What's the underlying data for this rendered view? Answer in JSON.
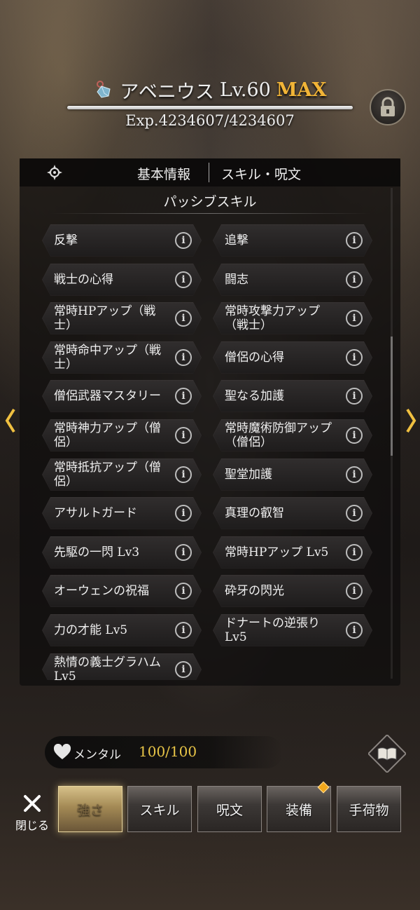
{
  "header": {
    "name": "アベニウス",
    "level": "Lv.60",
    "max_label": "MAX",
    "exp": "Exp.4234607/4234607"
  },
  "tabs": {
    "basic": "基本情報",
    "skill": "スキル・呪文"
  },
  "section_title": "パッシブスキル",
  "skills": [
    "反撃",
    "追撃",
    "戦士の心得",
    "闘志",
    "常時HPアップ（戦士）",
    "常時攻撃力アップ（戦士）",
    "常時命中アップ（戦士）",
    "僧侶の心得",
    "僧侶武器マスタリー",
    "聖なる加護",
    "常時神力アップ（僧侶）",
    "常時魔術防御アップ（僧侶）",
    "常時抵抗アップ（僧侶）",
    "聖堂加護",
    "アサルトガード",
    "真理の叡智",
    "先駆の一閃 Lv3",
    "常時HPアップ Lv5",
    "オーウェンの祝福",
    "砕牙の閃光",
    "力の才能 Lv5",
    "ドナートの逆張り Lv5",
    "熱情の義士グラハム Lv5"
  ],
  "info_glyph": "i",
  "mental": {
    "label": "メンタル",
    "value": "100/100"
  },
  "bottom_nav": {
    "close": "閉じる",
    "items": [
      "強さ",
      "スキル",
      "呪文",
      "装備",
      "手荷物"
    ]
  },
  "colors": {
    "max": "#f1b437",
    "mental_value": "#e8c547",
    "active_tab": "#d6c089",
    "badge": "#f2a81c"
  }
}
